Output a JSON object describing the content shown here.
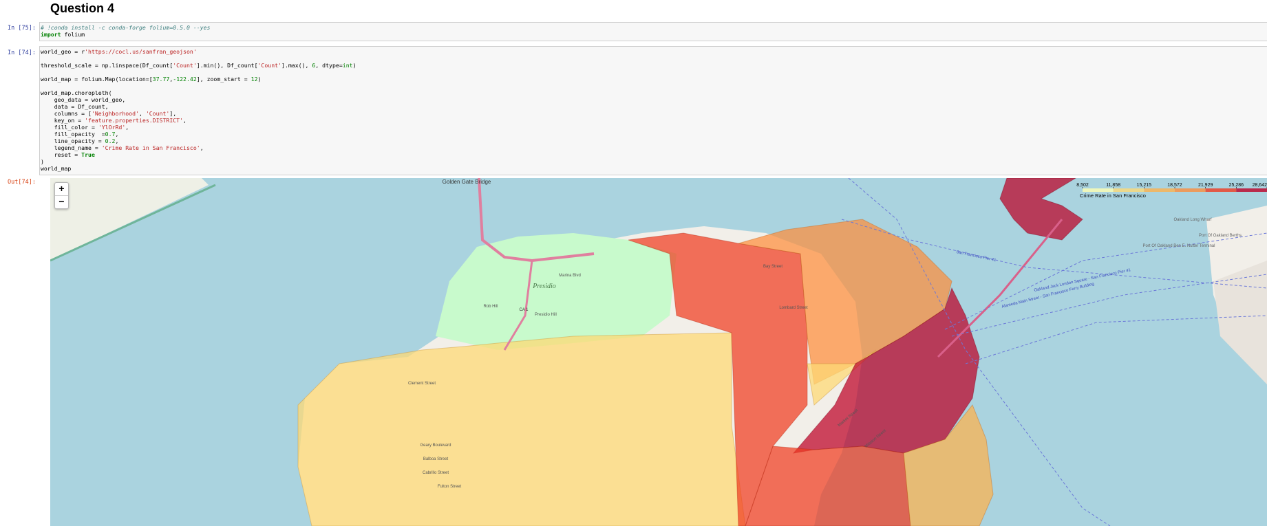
{
  "section": {
    "heading": "Question 4"
  },
  "cells": [
    {
      "prompt": "In [75]:",
      "lines": [
        [
          {
            "t": "# !conda install -c conda-forge folium=0.5.0 --yes",
            "c": "cm"
          }
        ],
        [
          {
            "t": "import",
            "c": "kw"
          },
          {
            "t": " folium"
          }
        ]
      ]
    },
    {
      "prompt": "In [74]:",
      "lines": [
        [
          {
            "t": "world_geo = r"
          },
          {
            "t": "'https://cocl.us/sanfran_geojson'",
            "c": "st"
          }
        ],
        [],
        [
          {
            "t": "threshold_scale = np.linspace(Df_count["
          },
          {
            "t": "'Count'",
            "c": "st"
          },
          {
            "t": "].min(), Df_count["
          },
          {
            "t": "'Count'",
            "c": "st"
          },
          {
            "t": "].max(), "
          },
          {
            "t": "6",
            "c": "nm"
          },
          {
            "t": ", dtype="
          },
          {
            "t": "int",
            "c": "nm"
          },
          {
            "t": ")"
          }
        ],
        [],
        [
          {
            "t": "world_map = folium.Map(location=["
          },
          {
            "t": "37.77",
            "c": "nm"
          },
          {
            "t": ","
          },
          {
            "t": "-122.42",
            "c": "nm"
          },
          {
            "t": "], zoom_start = "
          },
          {
            "t": "12",
            "c": "nm"
          },
          {
            "t": ")"
          }
        ],
        [],
        [
          {
            "t": "world_map.choropleth("
          }
        ],
        [
          {
            "t": "    geo_data = world_geo,"
          }
        ],
        [
          {
            "t": "    data = Df_count,"
          }
        ],
        [
          {
            "t": "    columns = ["
          },
          {
            "t": "'Neighborhood'",
            "c": "st"
          },
          {
            "t": ", "
          },
          {
            "t": "'Count'",
            "c": "st"
          },
          {
            "t": "],"
          }
        ],
        [
          {
            "t": "    key_on = "
          },
          {
            "t": "'feature.properties.DISTRICT'",
            "c": "st"
          },
          {
            "t": ","
          }
        ],
        [
          {
            "t": "    fill_color = "
          },
          {
            "t": "'YlOrRd'",
            "c": "st"
          },
          {
            "t": ","
          }
        ],
        [
          {
            "t": "    fill_opacity  ="
          },
          {
            "t": "0.7",
            "c": "nm"
          },
          {
            "t": ","
          }
        ],
        [
          {
            "t": "    line_opacity = "
          },
          {
            "t": "0.2",
            "c": "nm"
          },
          {
            "t": ","
          }
        ],
        [
          {
            "t": "    legend_name = "
          },
          {
            "t": "'Crime Rate in San Francisco'",
            "c": "st"
          },
          {
            "t": ","
          }
        ],
        [
          {
            "t": "    reset = "
          },
          {
            "t": "True",
            "c": "kw"
          }
        ],
        [
          {
            "t": ")"
          }
        ],
        [
          {
            "t": "world_map"
          }
        ]
      ]
    }
  ],
  "output": {
    "prompt": "Out[74]:",
    "map": {
      "zoom_in": "+",
      "zoom_out": "−",
      "legend": {
        "title": "Crime Rate in San Francisco",
        "ticks": [
          "8,502",
          "11,858",
          "15,215",
          "18,572",
          "21,929",
          "25,286",
          "28,642"
        ],
        "colors": [
          "#ffffb2",
          "#fed976",
          "#feb24c",
          "#fd8d3c",
          "#f03b20",
          "#bd0026"
        ]
      },
      "labels": [
        "Golden Gate Bridge",
        "Presidio",
        "Rob Hill",
        "Presidio Hill",
        "CA 1",
        "Marina Blvd",
        "Port Of Oakland Berths",
        "Port Of Oakland Ben E. Nutter Terminal",
        "Oakland Long Wharf",
        "San Francisco Pier 41",
        "Alameda Main Street - San Francisco Ferry Building",
        "Oakland Jack London Square - San Francisco Pier 41",
        "Lombard Street",
        "Bay Street",
        "Market Street",
        "Mission Street",
        "Fulton Street",
        "Geary Boulevard",
        "Balboa Street",
        "Cabrillo Street",
        "Clement Street"
      ]
    }
  },
  "colors": {
    "water": "#aad3df",
    "land": "#f2efe9",
    "park": "#c8facc",
    "choropleth_lightest": "#fed976",
    "choropleth_light": "#feb24c",
    "choropleth_mid": "#fd8d3c",
    "choropleth_high": "#f03b20",
    "choropleth_max": "#bd0026"
  }
}
